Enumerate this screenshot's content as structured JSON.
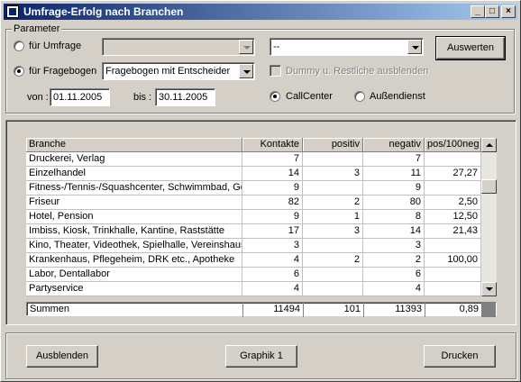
{
  "window": {
    "title": "Umfrage-Erfolg nach Branchen"
  },
  "params": {
    "legend": "Parameter",
    "radio_umfrage": "für Umfrage",
    "radio_fragebogen": "für Fragebogen",
    "umfrage_value": "",
    "fragebogen_value": "Fragebogen mit Entscheider",
    "second_combo_value": "--",
    "dummy_label": "Dummy u. Restliche ausblenden",
    "von_label": "von :",
    "von_value": "01.11.2005",
    "bis_label": "bis :",
    "bis_value": "30.11.2005",
    "callcenter_label": "CallCenter",
    "aussendienst_label": "Außendienst",
    "auswerten_label": "Auswerten"
  },
  "table": {
    "columns": [
      "Branche",
      "Kontakte",
      "positiv",
      "negativ",
      "pos/100neg"
    ],
    "rows": [
      [
        "Druckerei, Verlag",
        "7",
        "",
        "7",
        ""
      ],
      [
        "Einzelhandel",
        "14",
        "3",
        "11",
        "27,27"
      ],
      [
        "Fitness-/Tennis-/Squashcenter, Schwimmbad, Go",
        "9",
        "",
        "9",
        ""
      ],
      [
        "Friseur",
        "82",
        "2",
        "80",
        "2,50"
      ],
      [
        "Hotel, Pension",
        "9",
        "1",
        "8",
        "12,50"
      ],
      [
        "Imbiss, Kiosk, Trinkhalle, Kantine, Raststätte",
        "17",
        "3",
        "14",
        "21,43"
      ],
      [
        "Kino, Theater, Videothek, Spielhalle, Vereinshaus",
        "3",
        "",
        "3",
        ""
      ],
      [
        "Krankenhaus, Pflegeheim, DRK etc., Apotheke",
        "4",
        "2",
        "2",
        "100,00"
      ],
      [
        "Labor, Dentallabor",
        "6",
        "",
        "6",
        ""
      ],
      [
        "Partyservice",
        "4",
        "",
        "4",
        ""
      ]
    ],
    "summary": [
      "Summen",
      "11494",
      "101",
      "11393",
      "0,89"
    ]
  },
  "buttons": {
    "ausblenden": "Ausblenden",
    "graphik": "Graphik 1",
    "drucken": "Drucken"
  }
}
